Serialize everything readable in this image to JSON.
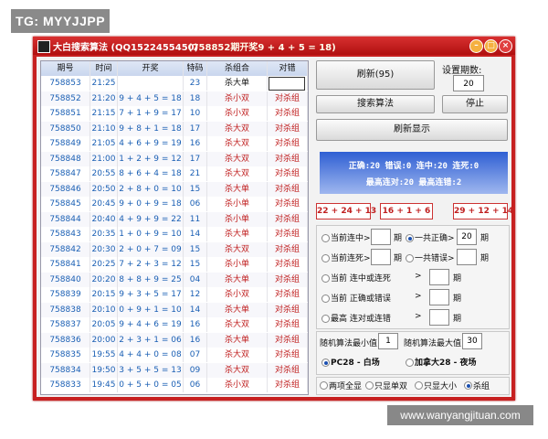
{
  "watermark_top": "TG: MYYJJPP",
  "watermark_bottom": "www.wanyangjituan.com",
  "window": {
    "title": "大白搜索算法 (QQ1522455450)",
    "latest": "(758852期开奖9 + 4 + 5 = 18)",
    "min": "–",
    "max": "□",
    "close": "×"
  },
  "table": {
    "headers": [
      "期号",
      "时间",
      "开奖",
      "特码",
      "杀组合",
      "对错"
    ],
    "rows": [
      {
        "issue": "758853",
        "time": "21:25",
        "draw": "",
        "code": "23",
        "kill": "杀大单",
        "result": ""
      },
      {
        "issue": "758852",
        "time": "21:20",
        "draw": "9 + 4 + 5 = 18",
        "code": "18",
        "kill": "杀小双",
        "result": "对杀组"
      },
      {
        "issue": "758851",
        "time": "21:15",
        "draw": "7 + 1 + 9 = 17",
        "code": "10",
        "kill": "杀小双",
        "result": "对杀组"
      },
      {
        "issue": "758850",
        "time": "21:10",
        "draw": "9 + 8 + 1 = 18",
        "code": "17",
        "kill": "杀大双",
        "result": "对杀组"
      },
      {
        "issue": "758849",
        "time": "21:05",
        "draw": "4 + 6 + 9 = 19",
        "code": "16",
        "kill": "杀大双",
        "result": "对杀组"
      },
      {
        "issue": "758848",
        "time": "21:00",
        "draw": "1 + 2 + 9 = 12",
        "code": "17",
        "kill": "杀大双",
        "result": "对杀组"
      },
      {
        "issue": "758847",
        "time": "20:55",
        "draw": "8 + 6 + 4 = 18",
        "code": "21",
        "kill": "杀大双",
        "result": "对杀组"
      },
      {
        "issue": "758846",
        "time": "20:50",
        "draw": "2 + 8 + 0 = 10",
        "code": "15",
        "kill": "杀大单",
        "result": "对杀组"
      },
      {
        "issue": "758845",
        "time": "20:45",
        "draw": "9 + 0 + 9 = 18",
        "code": "06",
        "kill": "杀小单",
        "result": "对杀组"
      },
      {
        "issue": "758844",
        "time": "20:40",
        "draw": "4 + 9 + 9 = 22",
        "code": "11",
        "kill": "杀小单",
        "result": "对杀组"
      },
      {
        "issue": "758843",
        "time": "20:35",
        "draw": "1 + 0 + 9 = 10",
        "code": "14",
        "kill": "杀大单",
        "result": "对杀组"
      },
      {
        "issue": "758842",
        "time": "20:30",
        "draw": "2 + 0 + 7 = 09",
        "code": "15",
        "kill": "杀大双",
        "result": "对杀组"
      },
      {
        "issue": "758841",
        "time": "20:25",
        "draw": "7 + 2 + 3 = 12",
        "code": "15",
        "kill": "杀小单",
        "result": "对杀组"
      },
      {
        "issue": "758840",
        "time": "20:20",
        "draw": "8 + 8 + 9 = 25",
        "code": "04",
        "kill": "杀大单",
        "result": "对杀组"
      },
      {
        "issue": "758839",
        "time": "20:15",
        "draw": "9 + 3 + 5 = 17",
        "code": "12",
        "kill": "杀小双",
        "result": "对杀组"
      },
      {
        "issue": "758838",
        "time": "20:10",
        "draw": "0 + 9 + 1 = 10",
        "code": "14",
        "kill": "杀大单",
        "result": "对杀组"
      },
      {
        "issue": "758837",
        "time": "20:05",
        "draw": "9 + 4 + 6 = 19",
        "code": "16",
        "kill": "杀大双",
        "result": "对杀组"
      },
      {
        "issue": "758836",
        "time": "20:00",
        "draw": "2 + 3 + 1 = 06",
        "code": "16",
        "kill": "杀大单",
        "result": "对杀组"
      },
      {
        "issue": "758835",
        "time": "19:55",
        "draw": "4 + 4 + 0 = 08",
        "code": "07",
        "kill": "杀大双",
        "result": "对杀组"
      },
      {
        "issue": "758834",
        "time": "19:50",
        "draw": "3 + 5 + 5 = 13",
        "code": "09",
        "kill": "杀大双",
        "result": "对杀组"
      },
      {
        "issue": "758833",
        "time": "19:45",
        "draw": "0 + 5 + 0 = 05",
        "code": "06",
        "kill": "杀小双",
        "result": "对杀组"
      }
    ]
  },
  "controls": {
    "refresh": "刷新(95)",
    "period_label": "设置期数:",
    "period_value": "20",
    "search": "搜索算法",
    "stop": "停止",
    "refresh_display": "刷新显示",
    "stats_line1": "正确:20 错误:0 连中:20 连死:0",
    "stats_line2": "最高连对:20 最高连错:2",
    "predictions": [
      "22 + 24 + 13",
      "16 + 1 + 6",
      "29 + 12 + 14"
    ],
    "current_hit": "当前连中>",
    "total_correct": "一共正确>",
    "total_correct_value": "20",
    "current_dead": "当前连死>",
    "total_wrong": "一共错误>",
    "period_unit": "期",
    "current_hit_or_dead": "当前 连中或连死",
    "current_correct_or_wrong": "当前 正确或错误",
    "max_correct_or_wrong": "最高 连对或连错",
    "gt": ">",
    "rand_min_label": "随机算法最小值",
    "rand_min": "1",
    "rand_max_label": "随机算法最大值",
    "rand_max": "30",
    "pc28": "PC28 - 白场",
    "canada": "加拿大28 - 夜场",
    "opt1": "两项全显",
    "opt2": "只显单双",
    "opt3": "只显大小",
    "opt4": "杀组"
  }
}
